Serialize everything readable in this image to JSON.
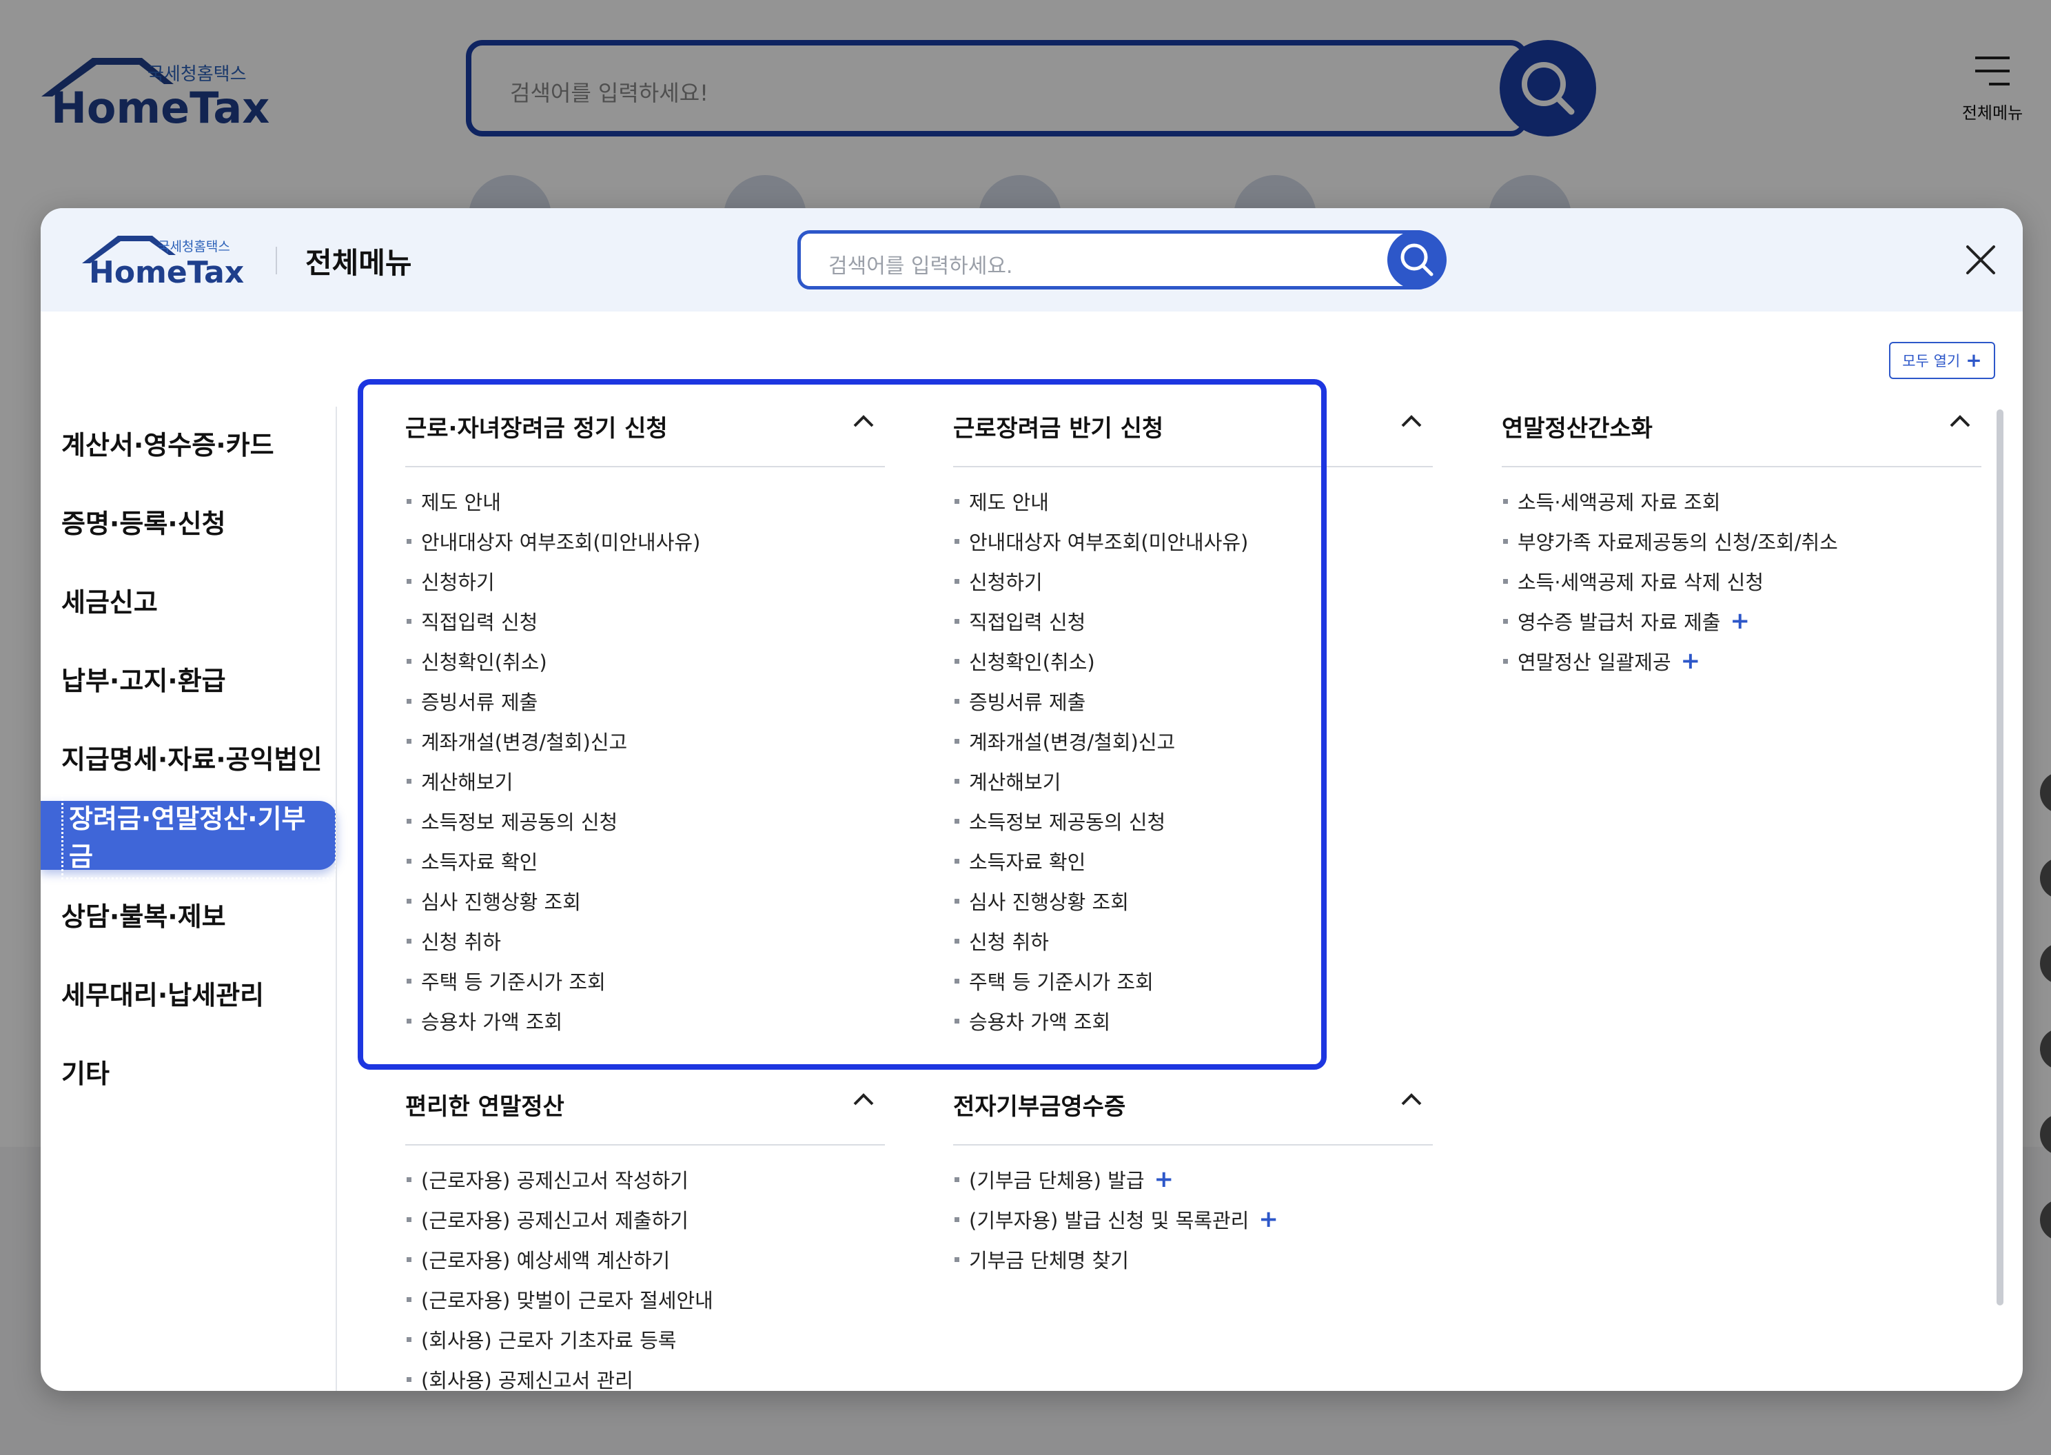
{
  "background": {
    "logo_top": "국세청홈택스",
    "logo_main": "HomeTax",
    "search_placeholder": "검색어를 입력하세요!",
    "menu_label": "전체메뉴"
  },
  "modal": {
    "logo_top": "국세청홈택스",
    "logo_main": "HomeTax",
    "title": "전체메뉴",
    "search_placeholder": "검색어를 입력하세요.",
    "expand_all_label": "모두 열기",
    "expand_all_icon": "+"
  },
  "sidebar": {
    "items": [
      {
        "label": "계산서·영수증·카드"
      },
      {
        "label": "증명·등록·신청"
      },
      {
        "label": "세금신고"
      },
      {
        "label": "납부·고지·환급"
      },
      {
        "label": "지급명세·자료·공익법인"
      },
      {
        "label": "장려금·연말정산·기부금",
        "active": true
      },
      {
        "label": "상담·불복·제보"
      },
      {
        "label": "세무대리·납세관리"
      },
      {
        "label": "기타"
      }
    ]
  },
  "sections": [
    {
      "title": "근로·자녀장려금 정기 신청",
      "items": [
        {
          "label": "제도 안내"
        },
        {
          "label": "안내대상자 여부조회(미안내사유)"
        },
        {
          "label": "신청하기"
        },
        {
          "label": "직접입력 신청"
        },
        {
          "label": "신청확인(취소)"
        },
        {
          "label": "증빙서류 제출"
        },
        {
          "label": "계좌개설(변경/철회)신고"
        },
        {
          "label": "계산해보기"
        },
        {
          "label": "소득정보 제공동의 신청"
        },
        {
          "label": "소득자료 확인"
        },
        {
          "label": "심사 진행상황 조회"
        },
        {
          "label": "신청 취하"
        },
        {
          "label": "주택 등 기준시가 조회"
        },
        {
          "label": "승용차 가액 조회"
        }
      ]
    },
    {
      "title": "근로장려금 반기 신청",
      "items": [
        {
          "label": "제도 안내"
        },
        {
          "label": "안내대상자 여부조회(미안내사유)"
        },
        {
          "label": "신청하기"
        },
        {
          "label": "직접입력 신청"
        },
        {
          "label": "신청확인(취소)"
        },
        {
          "label": "증빙서류 제출"
        },
        {
          "label": "계좌개설(변경/철회)신고"
        },
        {
          "label": "계산해보기"
        },
        {
          "label": "소득정보 제공동의 신청"
        },
        {
          "label": "소득자료 확인"
        },
        {
          "label": "심사 진행상황 조회"
        },
        {
          "label": "신청 취하"
        },
        {
          "label": "주택 등 기준시가 조회"
        },
        {
          "label": "승용차 가액 조회"
        }
      ]
    },
    {
      "title": "연말정산간소화",
      "items": [
        {
          "label": "소득·세액공제 자료 조회"
        },
        {
          "label": "부양가족 자료제공동의 신청/조회/취소"
        },
        {
          "label": "소득·세액공제 자료 삭제 신청"
        },
        {
          "label": "영수증 발급처 자료 제출",
          "plus": "+"
        },
        {
          "label": "연말정산 일괄제공",
          "plus": "+"
        }
      ]
    },
    {
      "title": "편리한 연말정산",
      "items": [
        {
          "label": "(근로자용) 공제신고서 작성하기"
        },
        {
          "label": "(근로자용) 공제신고서 제출하기"
        },
        {
          "label": "(근로자용) 예상세액 계산하기"
        },
        {
          "label": "(근로자용) 맞벌이 근로자 절세안내"
        },
        {
          "label": "(회사용) 근로자 기초자료 등록"
        },
        {
          "label": "(회사용) 공제신고서 관리"
        }
      ]
    },
    {
      "title": "전자기부금영수증",
      "items": [
        {
          "label": "(기부금 단체용) 발급",
          "plus": "+"
        },
        {
          "label": "(기부자용) 발급 신청 및 목록관리",
          "plus": "+"
        },
        {
          "label": "기부금 단체명 찾기"
        }
      ]
    }
  ],
  "colors": {
    "brand_blue": "#2d57c9",
    "highlight": "#1d36e0",
    "active_tab": "#3f66d8",
    "logo_navy": "#1f3f8c"
  }
}
